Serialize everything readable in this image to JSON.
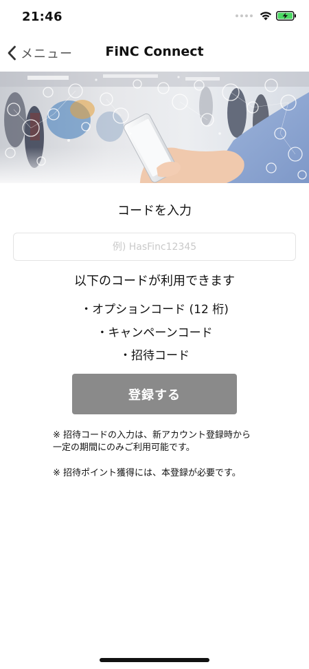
{
  "status_bar": {
    "time": "21:46",
    "icons": [
      "signal-dots-icon",
      "wifi-icon",
      "battery-charging-icon"
    ]
  },
  "nav": {
    "back_label": "メニュー",
    "title": "FiNC Connect"
  },
  "hero": {
    "description_icon": "hero-image"
  },
  "form": {
    "section_title": "コードを入力",
    "input_placeholder": "例) HasFinc12345",
    "input_value": "",
    "available_text": "以下のコードが利用できます",
    "code_types": [
      "・オプションコード (12 桁)",
      "・キャンペーンコード",
      "・招待コード"
    ],
    "register_label": "登録する"
  },
  "notes": [
    "※ 招待コードの入力は、新アカウント登録時から一定の期間にのみご利用可能です。",
    "※ 招待ポイント獲得には、本登録が必要です。"
  ],
  "colors": {
    "button_bg": "#8a8a8a",
    "button_text": "#ffffff",
    "input_border": "#e3e3e3",
    "placeholder": "#c9c9c9",
    "battery_fill": "#4cd964"
  }
}
